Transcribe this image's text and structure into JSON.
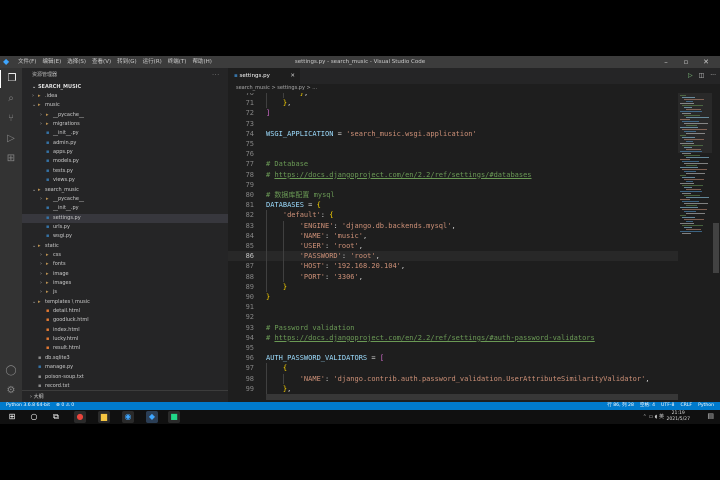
{
  "window": {
    "title": "settings.py - search_music - Visual Studio Code",
    "menus": [
      "文件(F)",
      "编辑(E)",
      "选择(S)",
      "查看(V)",
      "转到(G)",
      "运行(R)",
      "终端(T)",
      "帮助(H)"
    ]
  },
  "sidebar": {
    "header": "资源管理器",
    "root": "SEARCH_MUSIC",
    "items": [
      {
        "label": ".idea",
        "depth": 1,
        "folder": true,
        "open": false
      },
      {
        "label": "music",
        "depth": 1,
        "folder": true,
        "open": true
      },
      {
        "label": "__pycache__",
        "depth": 2,
        "folder": true,
        "open": false
      },
      {
        "label": "migrations",
        "depth": 2,
        "folder": true,
        "open": false
      },
      {
        "label": "__init__.py",
        "depth": 2,
        "folder": false
      },
      {
        "label": "admin.py",
        "depth": 2,
        "folder": false
      },
      {
        "label": "apps.py",
        "depth": 2,
        "folder": false
      },
      {
        "label": "models.py",
        "depth": 2,
        "folder": false
      },
      {
        "label": "tests.py",
        "depth": 2,
        "folder": false
      },
      {
        "label": "views.py",
        "depth": 2,
        "folder": false
      },
      {
        "label": "search_music",
        "depth": 1,
        "folder": true,
        "open": true
      },
      {
        "label": "__pycache__",
        "depth": 2,
        "folder": true,
        "open": false
      },
      {
        "label": "__init__.py",
        "depth": 2,
        "folder": false
      },
      {
        "label": "settings.py",
        "depth": 2,
        "folder": false,
        "selected": true
      },
      {
        "label": "urls.py",
        "depth": 2,
        "folder": false
      },
      {
        "label": "wsgi.py",
        "depth": 2,
        "folder": false
      },
      {
        "label": "static",
        "depth": 1,
        "folder": true,
        "open": true
      },
      {
        "label": "css",
        "depth": 2,
        "folder": true,
        "open": false
      },
      {
        "label": "fonts",
        "depth": 2,
        "folder": true,
        "open": false
      },
      {
        "label": "image",
        "depth": 2,
        "folder": true,
        "open": false
      },
      {
        "label": "images",
        "depth": 2,
        "folder": true,
        "open": false
      },
      {
        "label": "js",
        "depth": 2,
        "folder": true,
        "open": false
      },
      {
        "label": "templates \\ music",
        "depth": 1,
        "folder": true,
        "open": true
      },
      {
        "label": "detail.html",
        "depth": 2,
        "folder": false
      },
      {
        "label": "goodluck.html",
        "depth": 2,
        "folder": false
      },
      {
        "label": "index.html",
        "depth": 2,
        "folder": false
      },
      {
        "label": "lucky.html",
        "depth": 2,
        "folder": false
      },
      {
        "label": "result.html",
        "depth": 2,
        "folder": false
      },
      {
        "label": "db.sqlite3",
        "depth": 1,
        "folder": false
      },
      {
        "label": "manage.py",
        "depth": 1,
        "folder": false
      },
      {
        "label": "poison-soup.txt",
        "depth": 1,
        "folder": false
      },
      {
        "label": "record.txt",
        "depth": 1,
        "folder": false
      }
    ],
    "outline": "大纲"
  },
  "editor": {
    "tab": "settings.py",
    "breadcrumb": "search_music > settings.py > ...",
    "current_line": 86,
    "lines": [
      {
        "n": "70",
        "t": "        },"
      },
      {
        "n": "71",
        "t": "    },"
      },
      {
        "n": "72",
        "t": "]"
      },
      {
        "n": "73",
        "t": ""
      },
      {
        "n": "74",
        "t": "WSGI_APPLICATION = 'search_music.wsgi.application'"
      },
      {
        "n": "75",
        "t": ""
      },
      {
        "n": "76",
        "t": ""
      },
      {
        "n": "77",
        "t": "# Database"
      },
      {
        "n": "78",
        "t": "# https://docs.djangoproject.com/en/2.2/ref/settings/#databases"
      },
      {
        "n": "79",
        "t": ""
      },
      {
        "n": "80",
        "t": "# 数据库配置 mysql"
      },
      {
        "n": "81",
        "t": "DATABASES = {"
      },
      {
        "n": "82",
        "t": "    'default': {"
      },
      {
        "n": "83",
        "t": "        'ENGINE': 'django.db.backends.mysql',"
      },
      {
        "n": "84",
        "t": "        'NAME': 'music',"
      },
      {
        "n": "85",
        "t": "        'USER': 'root',"
      },
      {
        "n": "86",
        "t": "        'PASSWORD': 'root',"
      },
      {
        "n": "87",
        "t": "        'HOST': '192.168.20.104',"
      },
      {
        "n": "88",
        "t": "        'PORT': '3306',"
      },
      {
        "n": "89",
        "t": "    }"
      },
      {
        "n": "90",
        "t": "}"
      },
      {
        "n": "91",
        "t": ""
      },
      {
        "n": "92",
        "t": ""
      },
      {
        "n": "93",
        "t": "# Password validation"
      },
      {
        "n": "94",
        "t": "# https://docs.djangoproject.com/en/2.2/ref/settings/#auth-password-validators"
      },
      {
        "n": "95",
        "t": ""
      },
      {
        "n": "96",
        "t": "AUTH_PASSWORD_VALIDATORS = ["
      },
      {
        "n": "97",
        "t": "    {"
      },
      {
        "n": "98",
        "t": "        'NAME': 'django.contrib.auth.password_validation.UserAttributeSimilarityValidator',"
      },
      {
        "n": "99",
        "t": "    },"
      }
    ]
  },
  "status": {
    "left": [
      "Python 3.6.8 64-bit",
      "⊗ 0 ⚠ 0"
    ],
    "right": [
      "行 86, 列 28",
      "空格: 4",
      "UTF-8",
      "CRLF",
      "Python"
    ]
  },
  "taskbar": {
    "time": "21:19",
    "date": "2021/5/27"
  },
  "colors": {
    "accent": "#007acc",
    "editor_bg": "#1e1e1e",
    "sidebar_bg": "#252526",
    "activity_bg": "#333333"
  }
}
